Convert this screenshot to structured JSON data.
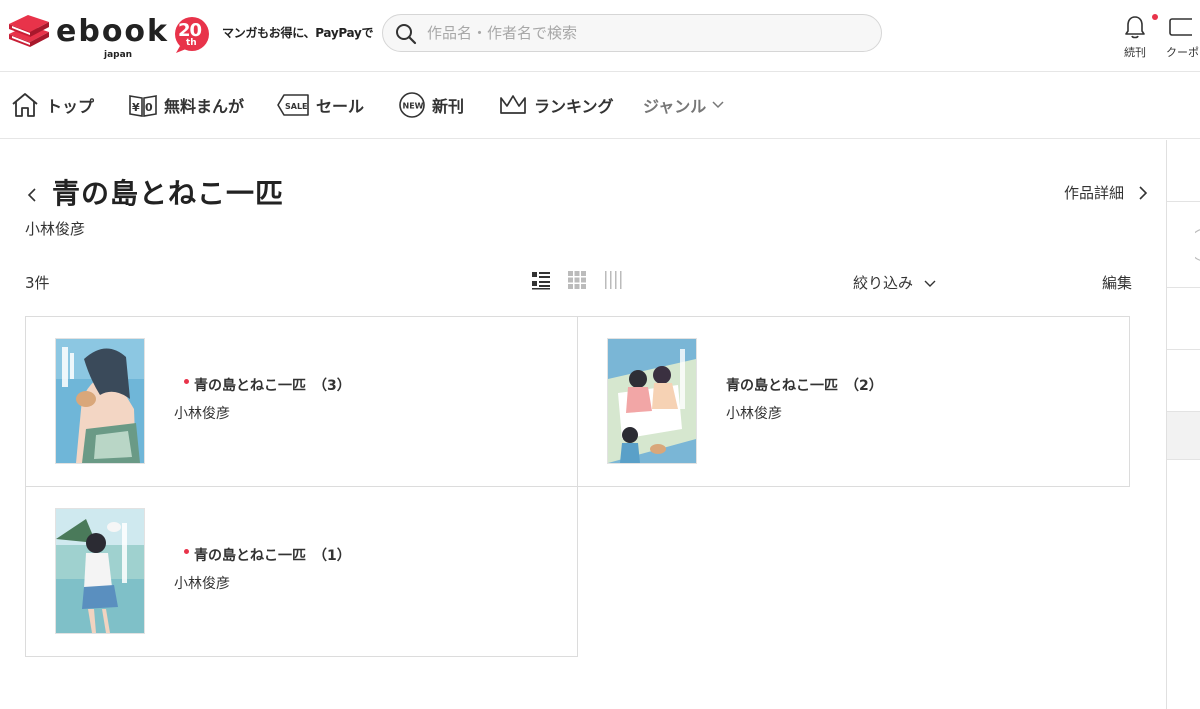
{
  "header": {
    "logo_text": "ebook",
    "logo_sub": "japan",
    "anniversary_badge": "20",
    "anniversary_suffix": "th",
    "tagline": "マンガもお得に、PayPayで",
    "search_placeholder": "作品名・作者名で検索",
    "notifications_label": "続刊",
    "coupon_label": "クーポ"
  },
  "nav": {
    "items": [
      {
        "label": "トップ",
        "icon": "home-icon"
      },
      {
        "label": "無料まんが",
        "icon": "free-yen-icon"
      },
      {
        "label": "セール",
        "icon": "sale-tag-icon"
      },
      {
        "label": "新刊",
        "icon": "new-badge-icon"
      },
      {
        "label": "ランキング",
        "icon": "crown-icon"
      },
      {
        "label": "ジャンル",
        "icon": "chevron-down-icon"
      }
    ]
  },
  "series": {
    "title": "青の島とねこ一匹",
    "author": "小林俊彦",
    "detail_link": "作品詳細",
    "count": "3件",
    "filter_label": "絞り込み",
    "edit_label": "編集"
  },
  "volumes": [
    {
      "title": "青の島とねこ一匹　（3）",
      "author": "小林俊彦",
      "new": true
    },
    {
      "title": "青の島とねこ一匹　（2）",
      "author": "小林俊彦",
      "new": false
    },
    {
      "title": "青の島とねこ一匹　（1）",
      "author": "小林俊彦",
      "new": true
    }
  ],
  "colors": {
    "brand_red": "#e8334a",
    "text": "#333333",
    "border": "#dcdcdc"
  }
}
